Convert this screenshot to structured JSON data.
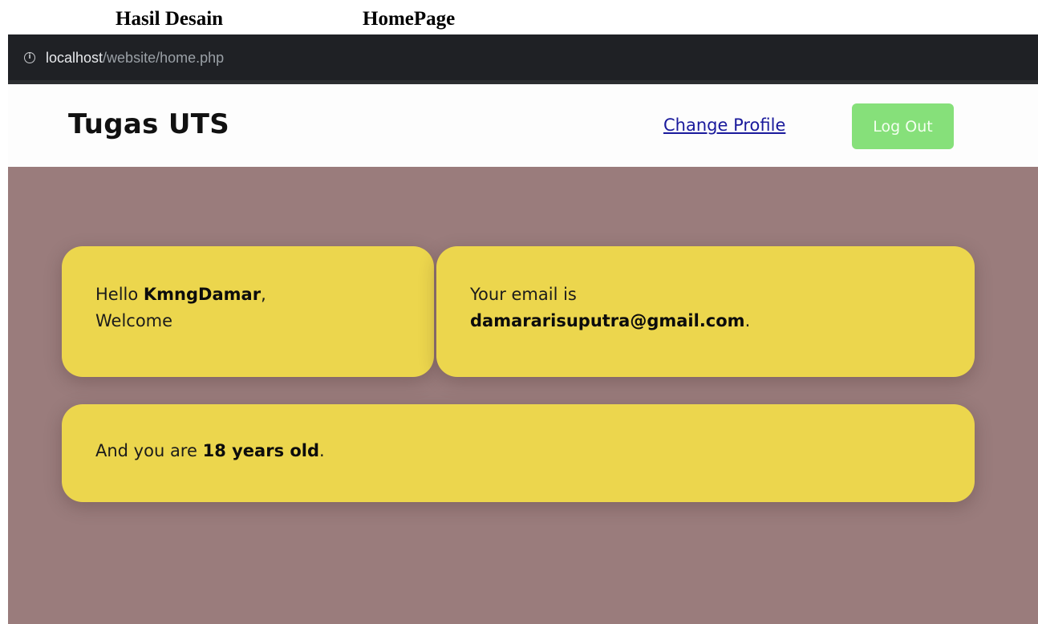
{
  "document": {
    "caption_left": "Hasil Desain",
    "caption_right": "HomePage"
  },
  "browser": {
    "url_host": "localhost",
    "url_path": "/website/home.php",
    "info_icon": "info-icon"
  },
  "navbar": {
    "brand": "Tugas UTS",
    "change_profile_label": "Change Profile",
    "logout_label": "Log Out"
  },
  "cards": {
    "welcome": {
      "greeting": "Hello ",
      "username": "KmngDamar",
      "comma": ",",
      "welcome_text": "Welcome"
    },
    "email": {
      "prefix": "Your email is",
      "email": "damararisuputra@gmail.com",
      "suffix": "."
    },
    "age": {
      "prefix": "And you are ",
      "age_text": "18 years old",
      "suffix": "."
    }
  },
  "colors": {
    "background": "#9a7c7c",
    "card": "#ecd64d",
    "logout_button": "#86e07a",
    "link": "#1a1a9c",
    "address_bar": "#1f2125"
  }
}
